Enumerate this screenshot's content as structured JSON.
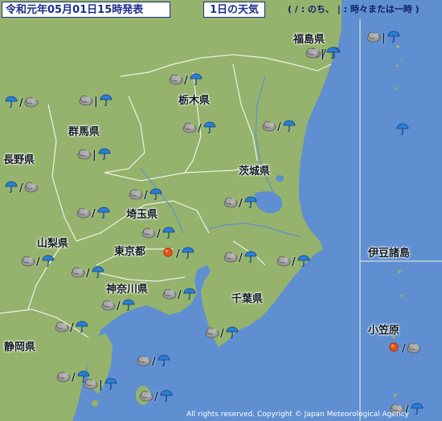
{
  "header": {
    "issued": "令和元年05月01日15時発表",
    "title": "1日の天気",
    "legend": "( / : のち、 | : 時々または一時 )"
  },
  "colors": {
    "sea": "#5f8fd0",
    "land": "#95b36c",
    "border": "#eef3e4",
    "header_text": "#1b2f8a"
  },
  "prefectures": [
    {
      "id": "fukushima",
      "name": "福島県"
    },
    {
      "id": "tochigi",
      "name": "栃木県"
    },
    {
      "id": "gunma",
      "name": "群馬県"
    },
    {
      "id": "nagano",
      "name": "長野県"
    },
    {
      "id": "ibaraki",
      "name": "茨城県"
    },
    {
      "id": "saitama",
      "name": "埼玉県"
    },
    {
      "id": "yamanashi",
      "name": "山梨県"
    },
    {
      "id": "tokyo",
      "name": "東京都"
    },
    {
      "id": "izu",
      "name": "伊豆諸島"
    },
    {
      "id": "kanagawa",
      "name": "神奈川県"
    },
    {
      "id": "chiba",
      "name": "千葉県"
    },
    {
      "id": "ogasawara",
      "name": "小笠原"
    },
    {
      "id": "shizuoka",
      "name": "静岡県"
    }
  ],
  "forecasts": [
    {
      "id": "f01",
      "first": "cloud-icon",
      "sep": "/",
      "second": "umbrella-icon"
    },
    {
      "id": "f02",
      "first": "cloud-icon",
      "sep": "|",
      "second": "umbrella-icon"
    },
    {
      "id": "f03",
      "first": "umbrella-icon",
      "sep": "/",
      "second": "cloud-icon"
    },
    {
      "id": "f04",
      "first": "cloud-icon",
      "sep": "|",
      "second": "umbrella-icon"
    },
    {
      "id": "f05",
      "first": "cloud-icon",
      "sep": "/",
      "second": "umbrella-icon"
    },
    {
      "id": "f06",
      "first": "cloud-icon",
      "sep": "/",
      "second": "umbrella-icon"
    },
    {
      "id": "f07",
      "first": "cloud-icon",
      "sep": "/",
      "second": "umbrella-icon"
    },
    {
      "id": "f08",
      "first": "cloud-icon",
      "sep": "|",
      "second": "umbrella-icon"
    },
    {
      "id": "f09",
      "first": "umbrella-icon",
      "sep": "/",
      "second": "cloud-icon"
    },
    {
      "id": "f10",
      "first": "cloud-icon",
      "sep": "/",
      "second": "umbrella-icon"
    },
    {
      "id": "f11",
      "first": "cloud-icon",
      "sep": "/",
      "second": "umbrella-icon"
    },
    {
      "id": "f12",
      "first": "cloud-icon",
      "sep": "/",
      "second": "umbrella-icon"
    },
    {
      "id": "f13",
      "first": "cloud-icon",
      "sep": "/",
      "second": "umbrella-icon"
    },
    {
      "id": "f14",
      "first": "cloud-icon",
      "sep": "/",
      "second": "umbrella-icon"
    },
    {
      "id": "f15",
      "first": "sun-icon",
      "sep": "/",
      "second": "umbrella-icon"
    },
    {
      "id": "f16",
      "first": "cloud-icon",
      "sep": "/",
      "second": "umbrella-icon"
    },
    {
      "id": "f17",
      "first": "cloud-icon",
      "sep": "/",
      "second": "umbrella-icon"
    },
    {
      "id": "f18",
      "first": "cloud-icon",
      "sep": "/",
      "second": "umbrella-icon"
    },
    {
      "id": "f19",
      "first": "cloud-icon",
      "sep": "/",
      "second": "umbrella-icon"
    },
    {
      "id": "f20",
      "first": "cloud-icon",
      "sep": "/",
      "second": "umbrella-icon"
    },
    {
      "id": "f21",
      "first": "cloud-icon",
      "sep": "/",
      "second": "umbrella-icon"
    },
    {
      "id": "f22",
      "first": "cloud-icon",
      "sep": "/",
      "second": "umbrella-icon"
    },
    {
      "id": "f23",
      "first": "cloud-icon",
      "sep": "|",
      "second": "umbrella-icon"
    },
    {
      "id": "f24",
      "first": "cloud-icon",
      "sep": "/",
      "second": "umbrella-icon"
    },
    {
      "id": "f25",
      "first": "cloud-icon",
      "sep": "|",
      "second": "umbrella-icon"
    },
    {
      "id": "f26",
      "first": "cloud-icon",
      "sep": "/",
      "second": "umbrella-icon"
    },
    {
      "id": "f27",
      "first": "cloud-icon",
      "sep": "/",
      "second": "umbrella-icon"
    },
    {
      "id": "f28",
      "first": "cloud-icon",
      "sep": "/",
      "second": "umbrella-icon"
    },
    {
      "id": "f29",
      "first": "umbrella-icon",
      "sep": "",
      "second": ""
    },
    {
      "id": "f30",
      "first": "sun-icon",
      "sep": "/",
      "second": "cloud-icon"
    }
  ],
  "copyright": "All rights reserved. Copyright © Japan Meteorological Agency"
}
